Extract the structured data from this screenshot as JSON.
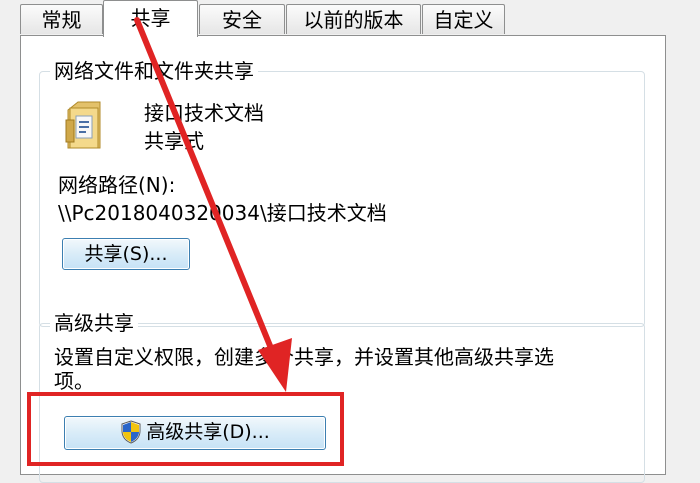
{
  "tabs": [
    {
      "label": "常规",
      "active": false
    },
    {
      "label": "共享",
      "active": true
    },
    {
      "label": "安全",
      "active": false
    },
    {
      "label": "以前的版本",
      "active": false
    },
    {
      "label": "自定义",
      "active": false
    }
  ],
  "network_share": {
    "group_title": "网络文件和文件夹共享",
    "item_name": "接口技术文档",
    "item_status": "共享式",
    "path_label": "网络路径(N):",
    "path_value": "\\\\Pc2018040320034\\接口技术文档",
    "share_button": "共享(S)..."
  },
  "advanced_share": {
    "group_title": "高级共享",
    "description_line1": "设置自定义权限，创建多个共享，并设置其他高级共享选",
    "description_line2": "项。",
    "button": "高级共享(D)..."
  },
  "annotation": {
    "color": "#e02424"
  }
}
